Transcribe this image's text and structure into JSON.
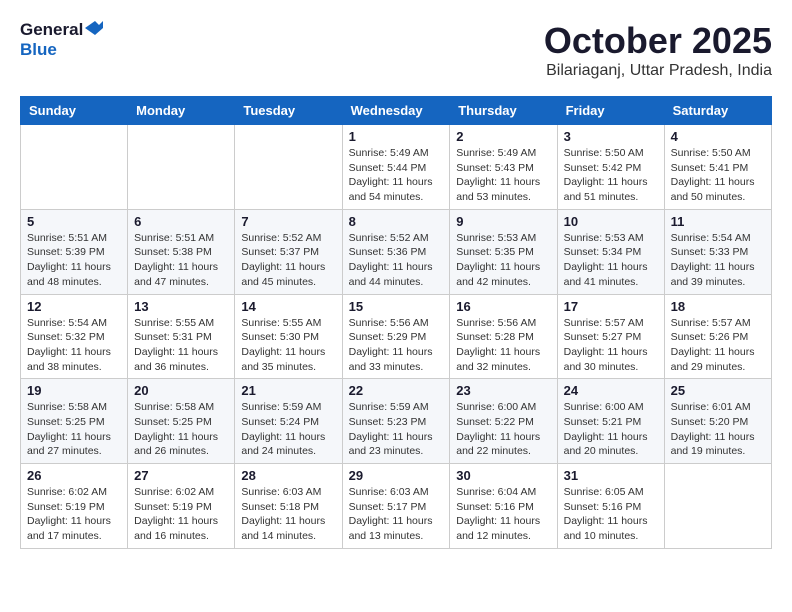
{
  "logo": {
    "line1": "General",
    "line2": "Blue"
  },
  "title": "October 2025",
  "subtitle": "Bilariaganj, Uttar Pradesh, India",
  "weekdays": [
    "Sunday",
    "Monday",
    "Tuesday",
    "Wednesday",
    "Thursday",
    "Friday",
    "Saturday"
  ],
  "weeks": [
    [
      {
        "day": "",
        "info": ""
      },
      {
        "day": "",
        "info": ""
      },
      {
        "day": "",
        "info": ""
      },
      {
        "day": "1",
        "info": "Sunrise: 5:49 AM\nSunset: 5:44 PM\nDaylight: 11 hours\nand 54 minutes."
      },
      {
        "day": "2",
        "info": "Sunrise: 5:49 AM\nSunset: 5:43 PM\nDaylight: 11 hours\nand 53 minutes."
      },
      {
        "day": "3",
        "info": "Sunrise: 5:50 AM\nSunset: 5:42 PM\nDaylight: 11 hours\nand 51 minutes."
      },
      {
        "day": "4",
        "info": "Sunrise: 5:50 AM\nSunset: 5:41 PM\nDaylight: 11 hours\nand 50 minutes."
      }
    ],
    [
      {
        "day": "5",
        "info": "Sunrise: 5:51 AM\nSunset: 5:39 PM\nDaylight: 11 hours\nand 48 minutes."
      },
      {
        "day": "6",
        "info": "Sunrise: 5:51 AM\nSunset: 5:38 PM\nDaylight: 11 hours\nand 47 minutes."
      },
      {
        "day": "7",
        "info": "Sunrise: 5:52 AM\nSunset: 5:37 PM\nDaylight: 11 hours\nand 45 minutes."
      },
      {
        "day": "8",
        "info": "Sunrise: 5:52 AM\nSunset: 5:36 PM\nDaylight: 11 hours\nand 44 minutes."
      },
      {
        "day": "9",
        "info": "Sunrise: 5:53 AM\nSunset: 5:35 PM\nDaylight: 11 hours\nand 42 minutes."
      },
      {
        "day": "10",
        "info": "Sunrise: 5:53 AM\nSunset: 5:34 PM\nDaylight: 11 hours\nand 41 minutes."
      },
      {
        "day": "11",
        "info": "Sunrise: 5:54 AM\nSunset: 5:33 PM\nDaylight: 11 hours\nand 39 minutes."
      }
    ],
    [
      {
        "day": "12",
        "info": "Sunrise: 5:54 AM\nSunset: 5:32 PM\nDaylight: 11 hours\nand 38 minutes."
      },
      {
        "day": "13",
        "info": "Sunrise: 5:55 AM\nSunset: 5:31 PM\nDaylight: 11 hours\nand 36 minutes."
      },
      {
        "day": "14",
        "info": "Sunrise: 5:55 AM\nSunset: 5:30 PM\nDaylight: 11 hours\nand 35 minutes."
      },
      {
        "day": "15",
        "info": "Sunrise: 5:56 AM\nSunset: 5:29 PM\nDaylight: 11 hours\nand 33 minutes."
      },
      {
        "day": "16",
        "info": "Sunrise: 5:56 AM\nSunset: 5:28 PM\nDaylight: 11 hours\nand 32 minutes."
      },
      {
        "day": "17",
        "info": "Sunrise: 5:57 AM\nSunset: 5:27 PM\nDaylight: 11 hours\nand 30 minutes."
      },
      {
        "day": "18",
        "info": "Sunrise: 5:57 AM\nSunset: 5:26 PM\nDaylight: 11 hours\nand 29 minutes."
      }
    ],
    [
      {
        "day": "19",
        "info": "Sunrise: 5:58 AM\nSunset: 5:25 PM\nDaylight: 11 hours\nand 27 minutes."
      },
      {
        "day": "20",
        "info": "Sunrise: 5:58 AM\nSunset: 5:25 PM\nDaylight: 11 hours\nand 26 minutes."
      },
      {
        "day": "21",
        "info": "Sunrise: 5:59 AM\nSunset: 5:24 PM\nDaylight: 11 hours\nand 24 minutes."
      },
      {
        "day": "22",
        "info": "Sunrise: 5:59 AM\nSunset: 5:23 PM\nDaylight: 11 hours\nand 23 minutes."
      },
      {
        "day": "23",
        "info": "Sunrise: 6:00 AM\nSunset: 5:22 PM\nDaylight: 11 hours\nand 22 minutes."
      },
      {
        "day": "24",
        "info": "Sunrise: 6:00 AM\nSunset: 5:21 PM\nDaylight: 11 hours\nand 20 minutes."
      },
      {
        "day": "25",
        "info": "Sunrise: 6:01 AM\nSunset: 5:20 PM\nDaylight: 11 hours\nand 19 minutes."
      }
    ],
    [
      {
        "day": "26",
        "info": "Sunrise: 6:02 AM\nSunset: 5:19 PM\nDaylight: 11 hours\nand 17 minutes."
      },
      {
        "day": "27",
        "info": "Sunrise: 6:02 AM\nSunset: 5:19 PM\nDaylight: 11 hours\nand 16 minutes."
      },
      {
        "day": "28",
        "info": "Sunrise: 6:03 AM\nSunset: 5:18 PM\nDaylight: 11 hours\nand 14 minutes."
      },
      {
        "day": "29",
        "info": "Sunrise: 6:03 AM\nSunset: 5:17 PM\nDaylight: 11 hours\nand 13 minutes."
      },
      {
        "day": "30",
        "info": "Sunrise: 6:04 AM\nSunset: 5:16 PM\nDaylight: 11 hours\nand 12 minutes."
      },
      {
        "day": "31",
        "info": "Sunrise: 6:05 AM\nSunset: 5:16 PM\nDaylight: 11 hours\nand 10 minutes."
      },
      {
        "day": "",
        "info": ""
      }
    ]
  ]
}
